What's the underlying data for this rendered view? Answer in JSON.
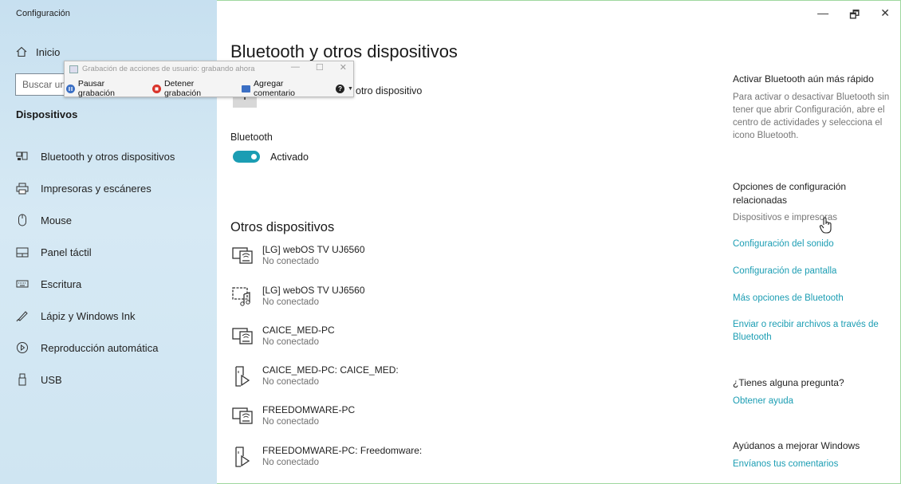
{
  "window": {
    "title": "Configuración",
    "minimize_glyph": "—",
    "restore_glyph": "🗗",
    "close_glyph": "✕"
  },
  "sidebar": {
    "home_label": "Inicio",
    "search_placeholder": "Buscar un",
    "section_label": "Dispositivos",
    "items": [
      {
        "label": "Bluetooth y otros dispositivos",
        "icon": "bluetooth-devices-icon"
      },
      {
        "label": "Impresoras y escáneres",
        "icon": "printer-icon"
      },
      {
        "label": "Mouse",
        "icon": "mouse-icon"
      },
      {
        "label": "Panel táctil",
        "icon": "touchpad-icon"
      },
      {
        "label": "Escritura",
        "icon": "keyboard-icon"
      },
      {
        "label": "Lápiz y Windows Ink",
        "icon": "pen-icon"
      },
      {
        "label": "Reproducción automática",
        "icon": "autoplay-icon"
      },
      {
        "label": "USB",
        "icon": "usb-icon"
      }
    ]
  },
  "recorder": {
    "title": "Grabación de acciones de usuario: grabando ahora",
    "pause_label": "Pausar grabación",
    "stop_label": "Detener grabación",
    "comment_label": "Agregar comentario",
    "help_glyph": "?",
    "minimize_glyph": "—",
    "maximize_glyph": "☐",
    "close_glyph": "✕"
  },
  "main": {
    "title": "Bluetooth y otros dispositivos",
    "add_device_label": "otro dispositivo",
    "bluetooth_label": "Bluetooth",
    "toggle_label": "Activado",
    "toggle_on": true,
    "others_title": "Otros dispositivos",
    "devices": [
      {
        "name": "[LG] webOS TV UJ6560",
        "status": "No conectado",
        "icon": "tv-icon"
      },
      {
        "name": "[LG] webOS TV UJ6560",
        "status": "No conectado",
        "icon": "media-device-icon"
      },
      {
        "name": "CAICE_MED-PC",
        "status": "No conectado",
        "icon": "tv-icon"
      },
      {
        "name": "CAICE_MED-PC: CAICE_MED:",
        "status": "No conectado",
        "icon": "media-player-icon"
      },
      {
        "name": "FREEDOMWARE-PC",
        "status": "No conectado",
        "icon": "tv-icon"
      },
      {
        "name": "FREEDOMWARE-PC: Freedomware:",
        "status": "No conectado",
        "icon": "media-player-icon"
      }
    ]
  },
  "right": {
    "fast_title": "Activar Bluetooth aún más rápido",
    "fast_text": "Para activar o desactivar Bluetooth sin tener que abrir Configuración, abre el centro de actividades y selecciona el icono Bluetooth.",
    "related_title": "Opciones de configuración relacionadas",
    "devices_printers": "Dispositivos e impresoras",
    "sound_link": "Configuración del sonido",
    "display_link": "Configuración de pantalla",
    "more_bt_link": "Más opciones de Bluetooth",
    "send_files_link": "Enviar o recibir archivos a través de Bluetooth",
    "question_title": "¿Tienes alguna pregunta?",
    "help_link": "Obtener ayuda",
    "improve_title": "Ayúdanos a mejorar Windows",
    "feedback_link": "Envíanos tus comentarios"
  },
  "colors": {
    "accent": "#1b9db3",
    "sidebar_bg": "#cfe5f2",
    "record_red": "#d9342b",
    "pause_blue": "#3b6fc4"
  }
}
